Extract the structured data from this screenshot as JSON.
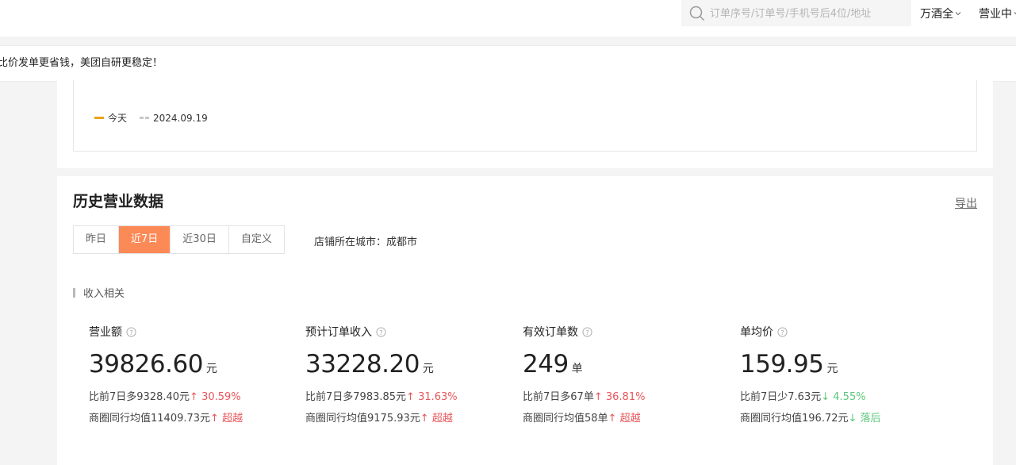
{
  "topbar": {
    "search_placeholder": "订单序号/订单号/手机号后4位/地址",
    "user_menu": "万酒全",
    "status_menu": "营业中"
  },
  "notice": {
    "text": "比价发单更省钱，美团自研更稳定！"
  },
  "chart": {
    "legend": [
      {
        "label": "今天",
        "color": "#e8a21b"
      },
      {
        "label": "2024.09.19",
        "color": "#c7c7c7"
      }
    ]
  },
  "history": {
    "title": "历史营业数据",
    "export_label": "导出",
    "tabs": [
      "昨日",
      "近7日",
      "近30日",
      "自定义"
    ],
    "active_tab": "近7日",
    "city_label": "店铺所在城市：",
    "city_value": "成都市",
    "section_label": "收入相关",
    "metrics": [
      {
        "label": "营业额",
        "value": "39826.60",
        "unit": "元",
        "compare_text": "比前7日多9328.40元",
        "compare_arrow": "↑",
        "compare_pct": "30.59%",
        "peer_text": "商圈同行均值11409.73元",
        "peer_arrow": "↑",
        "peer_status": "超越"
      },
      {
        "label": "预计订单收入",
        "value": "33228.20",
        "unit": "元",
        "compare_text": "比前7日多7983.85元",
        "compare_arrow": "↑",
        "compare_pct": "31.63%",
        "peer_text": "商圈同行均值9175.93元",
        "peer_arrow": "↑",
        "peer_status": "超越"
      },
      {
        "label": "有效订单数",
        "value": "249",
        "unit": "单",
        "compare_text": "比前7日多67单",
        "compare_arrow": "↑",
        "compare_pct": "36.81%",
        "peer_text": "商圈同行均值58单",
        "peer_arrow": "↑",
        "peer_status": "超越"
      },
      {
        "label": "单均价",
        "value": "159.95",
        "unit": "元",
        "compare_text": "比前7日少7.63元",
        "compare_arrow": "↓",
        "compare_pct": "4.55%",
        "peer_text": "商圈同行均值196.72元",
        "peer_arrow": "↓",
        "peer_status": "落后"
      }
    ]
  },
  "colors": {
    "accent": "#fb8a57",
    "up": "#e8555a",
    "down": "#5bc87a"
  }
}
